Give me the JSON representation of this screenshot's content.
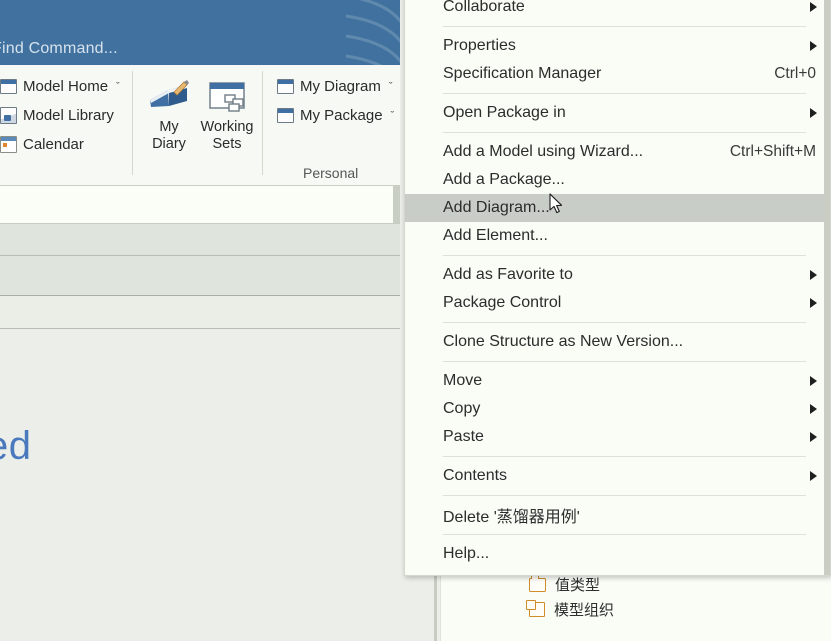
{
  "ribbon": {
    "search": {
      "placeholder": "Find Command...",
      "name": "find-command-search"
    },
    "small_commands": [
      {
        "label": "Model Home",
        "icon": "window-icon",
        "caret": "ˇ"
      },
      {
        "label": "Model Library",
        "icon": "library-icon",
        "caret": ""
      },
      {
        "label": "Calendar",
        "icon": "calendar-icon",
        "caret": ""
      }
    ],
    "big_commands": [
      {
        "line1": "My",
        "line2": "Diary",
        "icon": "diary-book-icon"
      },
      {
        "line1": "Working",
        "line2": "Sets",
        "icon": "working-sets-icon"
      }
    ],
    "personal_commands": [
      {
        "label": "My Diagram",
        "icon": "diagram-window-icon",
        "caret": "ˇ"
      },
      {
        "label": "My Package",
        "icon": "package-window-icon",
        "caret": "ˇ"
      }
    ],
    "group_name": "Personal"
  },
  "background": {
    "partial_heading": "ed"
  },
  "tree": {
    "ellipsis": "···",
    "items": [
      {
        "label": "值类型",
        "icon": "folder-icon"
      },
      {
        "label": "模型组织",
        "icon": "package-icon"
      }
    ]
  },
  "context_menu": {
    "items": [
      {
        "type": "item",
        "label": "Collaborate",
        "accel": "",
        "arrow": true,
        "selected": false,
        "name": "menu-item-collaborate"
      },
      {
        "type": "separator"
      },
      {
        "type": "item",
        "label": "Properties",
        "accel": "",
        "arrow": true,
        "selected": false,
        "name": "menu-item-properties"
      },
      {
        "type": "item",
        "label": "Specification Manager",
        "accel": "Ctrl+0",
        "arrow": false,
        "selected": false,
        "name": "menu-item-specification-manager"
      },
      {
        "type": "separator"
      },
      {
        "type": "item",
        "label": "Open Package in",
        "accel": "",
        "arrow": true,
        "selected": false,
        "name": "menu-item-open-package-in"
      },
      {
        "type": "separator"
      },
      {
        "type": "item",
        "label": "Add a Model using Wizard...",
        "accel": "Ctrl+Shift+M",
        "arrow": false,
        "selected": false,
        "name": "menu-item-add-a-model-using-wizard"
      },
      {
        "type": "item",
        "label": "Add a Package...",
        "accel": "",
        "arrow": false,
        "selected": false,
        "name": "menu-item-add-a-package"
      },
      {
        "type": "item",
        "label": "Add Diagram...",
        "accel": "",
        "arrow": false,
        "selected": true,
        "name": "menu-item-add-diagram"
      },
      {
        "type": "item",
        "label": "Add Element...",
        "accel": "",
        "arrow": false,
        "selected": false,
        "name": "menu-item-add-element"
      },
      {
        "type": "separator"
      },
      {
        "type": "item",
        "label": "Add as Favorite to",
        "accel": "",
        "arrow": true,
        "selected": false,
        "name": "menu-item-add-as-favorite-to"
      },
      {
        "type": "item",
        "label": "Package Control",
        "accel": "",
        "arrow": true,
        "selected": false,
        "name": "menu-item-package-control"
      },
      {
        "type": "separator"
      },
      {
        "type": "item",
        "label": "Clone Structure as New Version...",
        "accel": "",
        "arrow": false,
        "selected": false,
        "name": "menu-item-clone-structure-as-new-version"
      },
      {
        "type": "separator"
      },
      {
        "type": "item",
        "label": "Move",
        "accel": "",
        "arrow": true,
        "selected": false,
        "name": "menu-item-move"
      },
      {
        "type": "item",
        "label": "Copy",
        "accel": "",
        "arrow": true,
        "selected": false,
        "name": "menu-item-copy"
      },
      {
        "type": "item",
        "label": "Paste",
        "accel": "",
        "arrow": true,
        "selected": false,
        "name": "menu-item-paste"
      },
      {
        "type": "separator"
      },
      {
        "type": "item",
        "label": "Contents",
        "accel": "",
        "arrow": true,
        "selected": false,
        "name": "menu-item-contents"
      },
      {
        "type": "separator"
      },
      {
        "type": "item",
        "label": "Delete '蒸馏器用例'",
        "accel": "",
        "arrow": false,
        "selected": false,
        "name": "menu-item-delete"
      },
      {
        "type": "separator"
      },
      {
        "type": "item",
        "label": "Help...",
        "accel": "",
        "arrow": false,
        "selected": false,
        "name": "menu-item-help"
      }
    ]
  },
  "colors": {
    "ribbon_blue": "#41729f",
    "menu_bg": "#fafdf6",
    "menu_selected": "#c9cdc7",
    "panel_gray": "#dfe4dc",
    "accent_blue_text": "#4a79bd",
    "icon_orange": "#d08c2a"
  }
}
